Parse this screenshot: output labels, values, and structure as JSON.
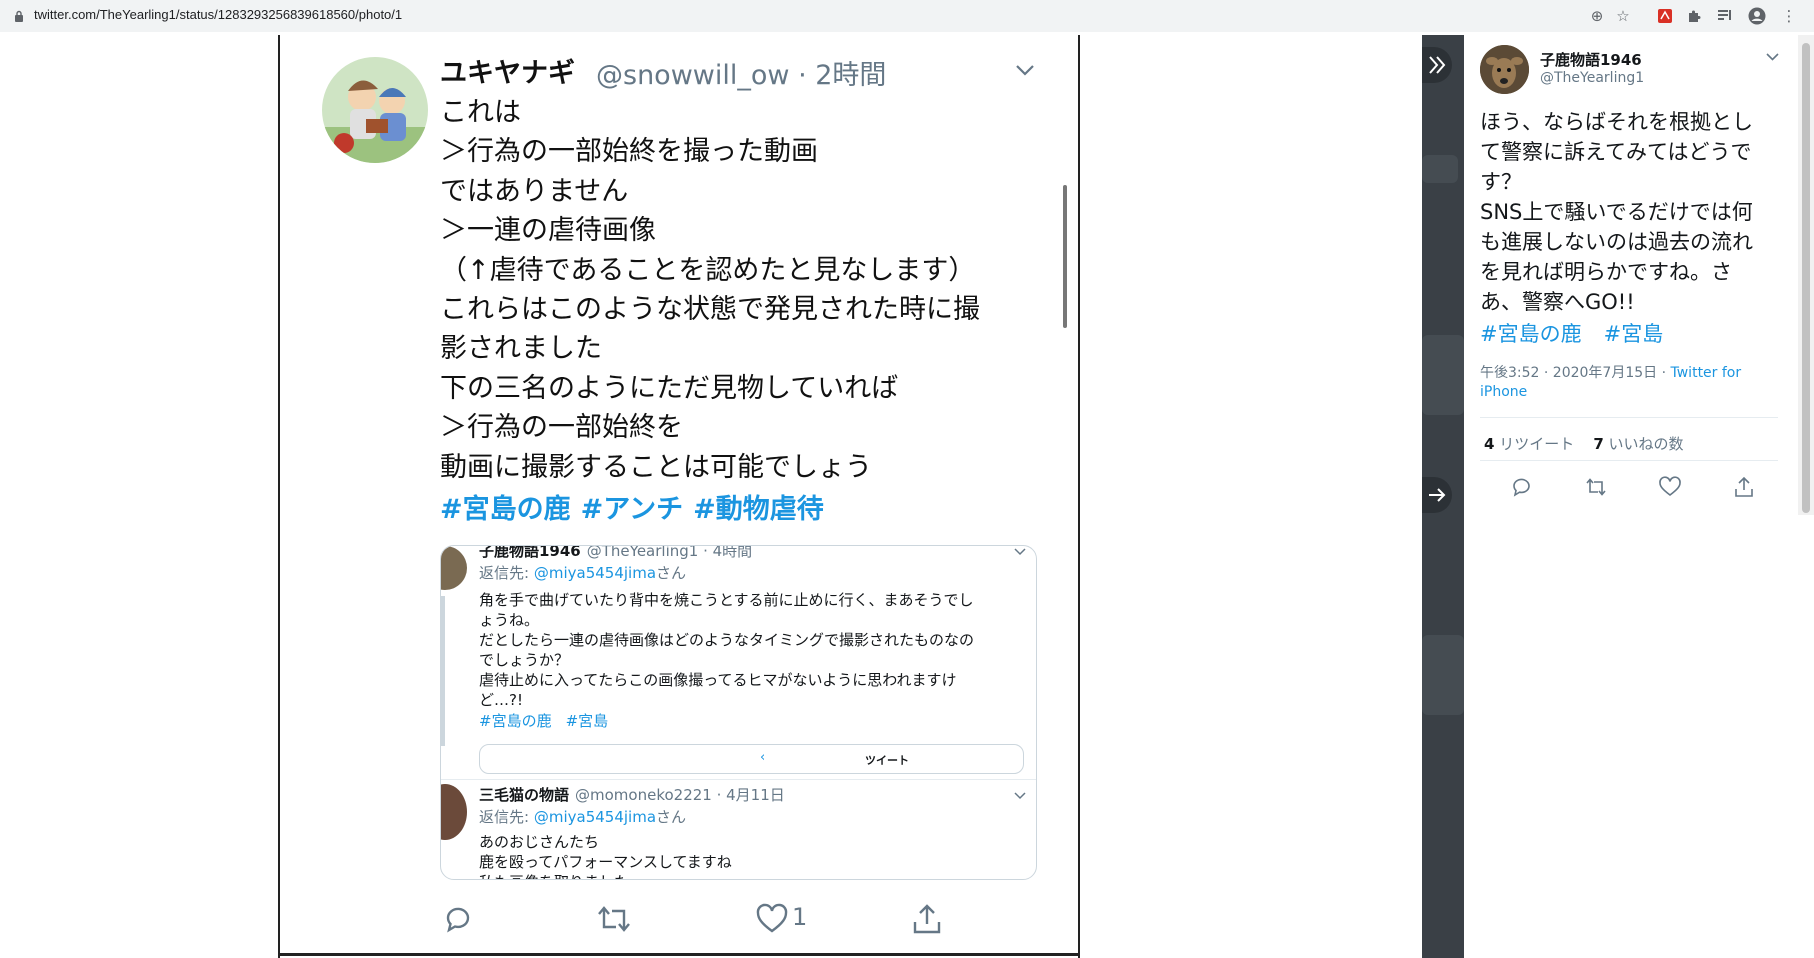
{
  "browser": {
    "url": "twitter.com/TheYearling1/status/1283293256839618560/photo/1",
    "extension_icons": [
      "add-circle-icon",
      "star-icon",
      "pdf-icon",
      "puzzle-icon",
      "playlist-icon",
      "account-icon",
      "menu-dots-icon"
    ]
  },
  "photo_tweet": {
    "name": "ユキヤナギ",
    "handle": "@snowwill_ow",
    "time": "· 2時間",
    "lines": [
      "これは",
      "＞行為の一部始終を撮った動画",
      "ではありません",
      "＞一連の虐待画像",
      "（↑虐待であることを認めたと見なします）",
      "これらはこのような状態で発見された時に撮",
      "影されました",
      "下の三名のようにただ見物していれば",
      "＞行為の一部始終を",
      "動画に撮影することは可能でしょう"
    ],
    "hashtags": [
      "#宮島の鹿",
      "#アンチ",
      "#動物虐待"
    ],
    "like_count": "1",
    "quote": {
      "tweet1": {
        "name": "子鹿物語1946",
        "handle": "@TheYearling1 · 4時間",
        "reply_prefix": "返信先:",
        "reply_mention": "@miya5454jima",
        "reply_suffix": "さん",
        "lines": [
          "角を手で曲げていたり背中を焼こうとする前に止めに行く、まあそうでし",
          "ょうね。",
          "だとしたら一連の虐待画像はどのようなタイミングで撮影されたものなの",
          "でしょうか？",
          "虐待止めに入ってたらこの画像撮ってるヒマがないように思われますけ",
          "ど…?!"
        ],
        "hashtags": [
          "#宮島の鹿",
          "#宮島"
        ],
        "card_title": "ツイート"
      },
      "tweet2": {
        "name": "三毛猫の物語",
        "handle": "@momoneko2221 · 4月11日",
        "reply_prefix": "返信先:",
        "reply_mention": "@miya5454jima",
        "reply_suffix": "さん",
        "lines": [
          "あのおじさんたち",
          "鹿を殴ってパフォーマンスしてますね",
          "私も画像を取りました"
        ]
      }
    }
  },
  "panel": {
    "name": "子鹿物語1946",
    "handle": "@TheYearling1",
    "lines": [
      "ほう、ならばそれを根拠とし",
      "て警察に訴えてみてはどうで",
      "す？",
      "SNS上で騒いでるだけでは何",
      "も進展しないのは過去の流れ",
      "を見れば明らかですね。さ",
      "あ、警察へGO!!"
    ],
    "hashtags": [
      "#宮島の鹿",
      "#宮島"
    ],
    "meta": "午後3:52 · 2020年7月15日 · ",
    "source": "Twitter for iPhone",
    "retweet_count": "4",
    "retweet_label": "リツイート",
    "like_count": "7",
    "like_label": "いいねの数"
  },
  "colors": {
    "link": "#1b95e0",
    "secondary": "#657786",
    "strip": "#3a4046"
  }
}
